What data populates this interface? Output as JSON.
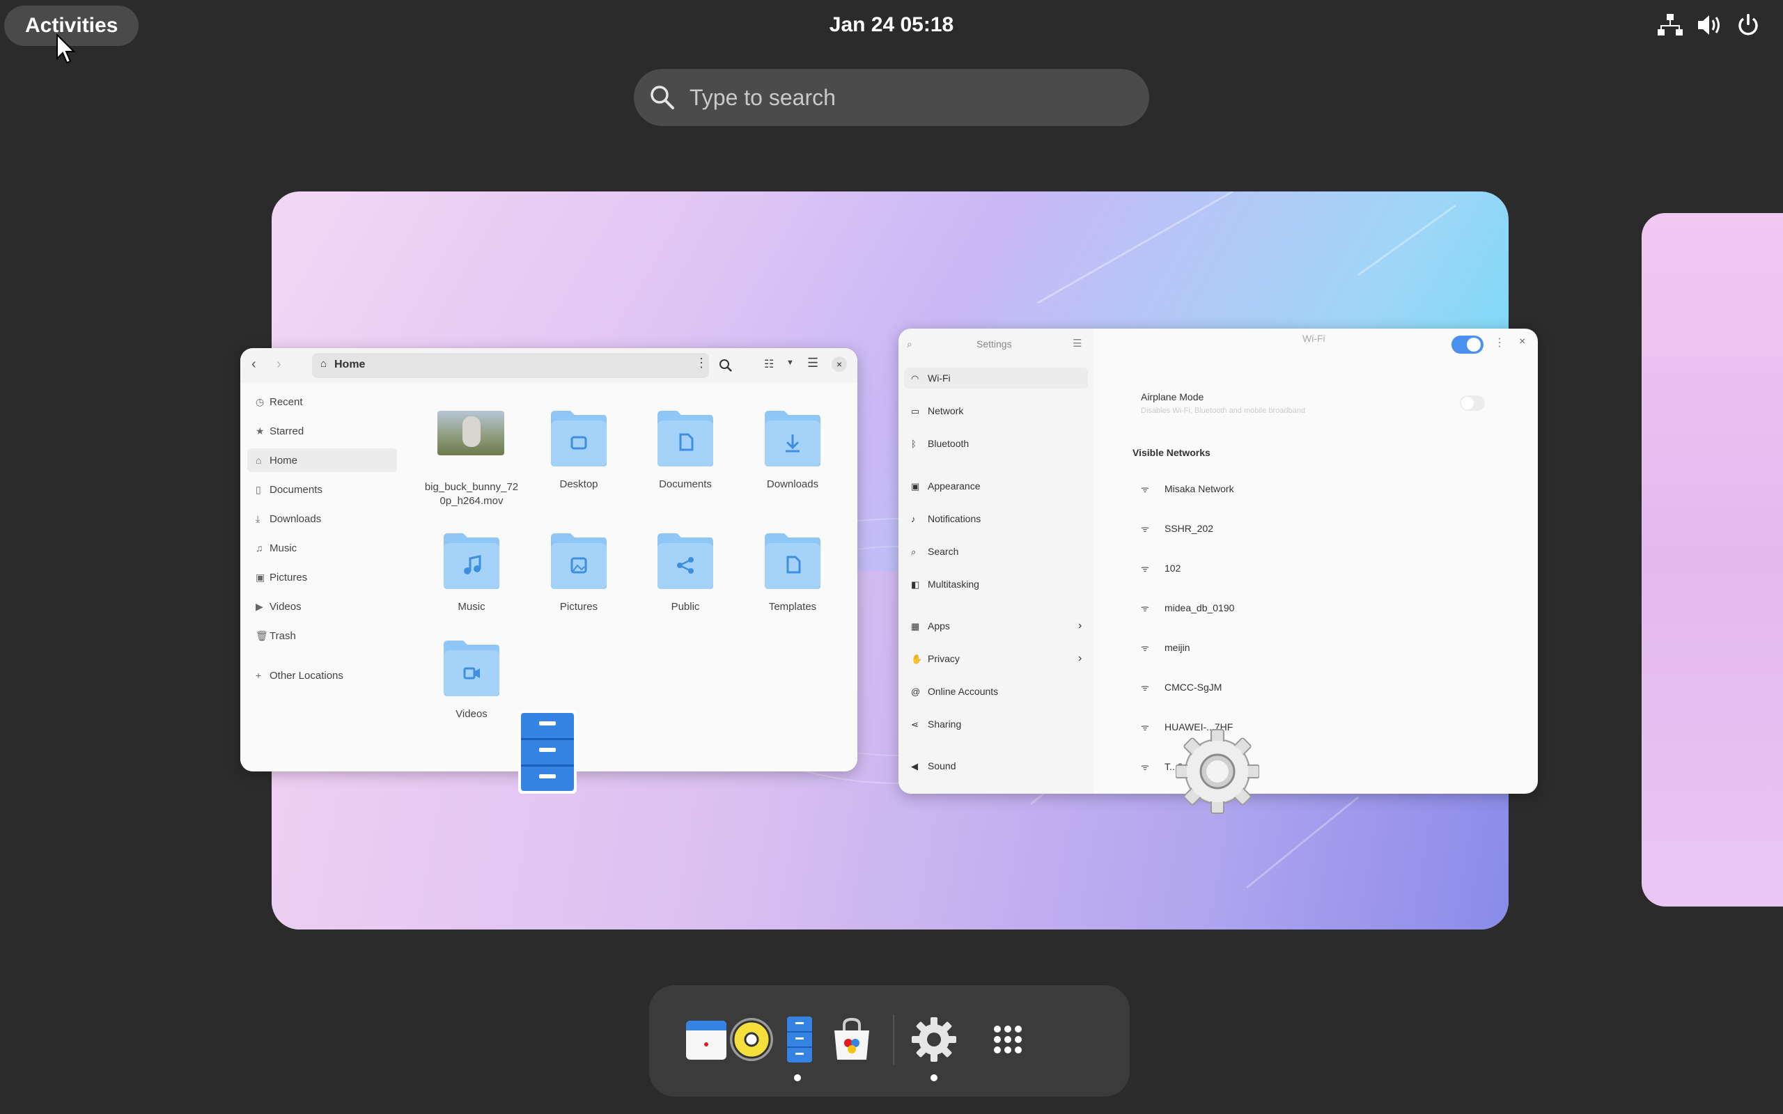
{
  "topbar": {
    "activities_label": "Activities",
    "clock": "Jan 24  05:18",
    "icons": [
      "network-wired-icon",
      "volume-icon",
      "power-icon"
    ]
  },
  "search": {
    "placeholder": "Type to search"
  },
  "files": {
    "path_label": "Home",
    "sidebar": [
      {
        "label": "Recent",
        "icon": "clock-icon"
      },
      {
        "label": "Starred",
        "icon": "star-icon"
      },
      {
        "label": "Home",
        "icon": "home-icon"
      },
      {
        "label": "Documents",
        "icon": "document-icon"
      },
      {
        "label": "Downloads",
        "icon": "download-icon"
      },
      {
        "label": "Music",
        "icon": "music-icon"
      },
      {
        "label": "Pictures",
        "icon": "picture-icon"
      },
      {
        "label": "Videos",
        "icon": "video-icon"
      },
      {
        "label": "Trash",
        "icon": "trash-icon"
      },
      {
        "label": "Other Locations",
        "icon": "plus-icon"
      }
    ],
    "items": [
      {
        "label": "big_buck_bunny_72",
        "label2": "0p_h264.mov",
        "type": "video"
      },
      {
        "label": "Desktop",
        "type": "folder"
      },
      {
        "label": "Documents",
        "type": "folder"
      },
      {
        "label": "Downloads",
        "type": "folder"
      },
      {
        "label": "Music",
        "type": "folder"
      },
      {
        "label": "Pictures",
        "type": "folder"
      },
      {
        "label": "Public",
        "type": "folder"
      },
      {
        "label": "Templates",
        "type": "folder"
      },
      {
        "label": "Videos",
        "type": "folder"
      }
    ]
  },
  "settings": {
    "sidebar_title": "Settings",
    "page_title": "Wi-Fi",
    "sidebar": [
      {
        "label": "Wi-Fi"
      },
      {
        "label": "Network"
      },
      {
        "label": "Bluetooth"
      },
      {
        "label": "Appearance"
      },
      {
        "label": "Notifications"
      },
      {
        "label": "Search"
      },
      {
        "label": "Multitasking"
      },
      {
        "label": "Apps"
      },
      {
        "label": "Privacy"
      },
      {
        "label": "Online Accounts"
      },
      {
        "label": "Sharing"
      },
      {
        "label": "Sound"
      }
    ],
    "airplane_mode": "Airplane Mode",
    "airplane_sub": "Disables Wi-Fi, Bluetooth and mobile broadband",
    "visible_networks": "Visible Networks",
    "networks": [
      "Misaka Network",
      "SSHR_202",
      "102",
      "midea_db_0190",
      "meijin",
      "CMCC-SgJM",
      "HUAWEI-...7HF",
      "T...94FB"
    ]
  },
  "dock": {
    "apps": [
      "calendar-app-icon",
      "rhythmbox-app-icon",
      "files-app-icon",
      "software-app-icon",
      "settings-app-icon",
      "app-grid-icon"
    ]
  },
  "colors": {
    "toggle_blue": "#4a90f0",
    "folder_blue": "#8ec6f6"
  }
}
